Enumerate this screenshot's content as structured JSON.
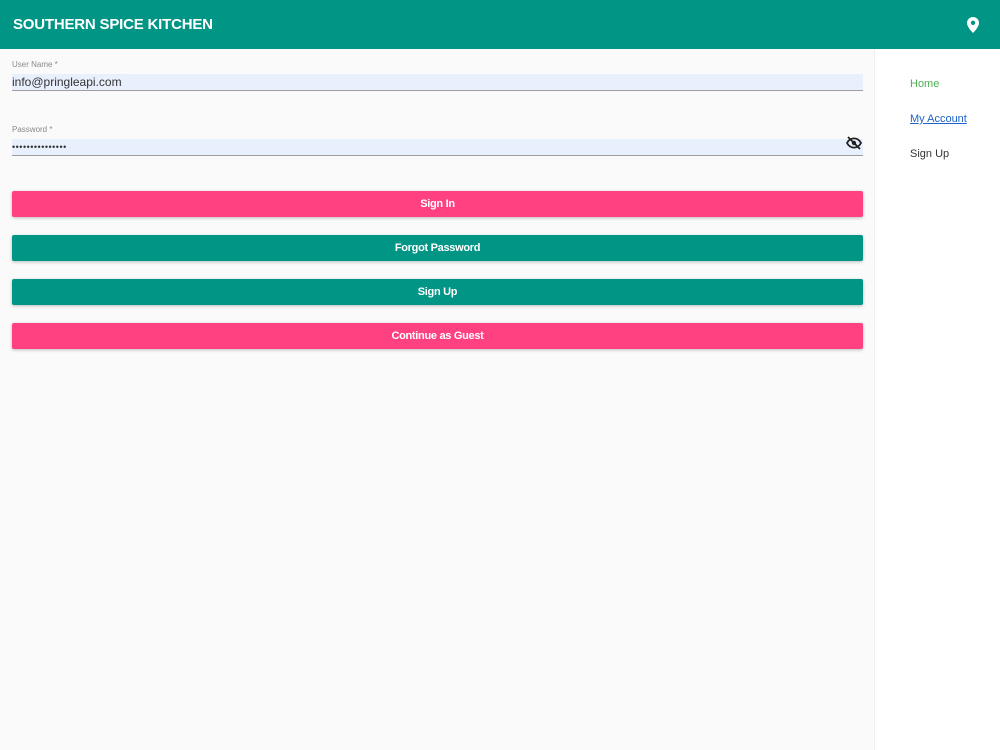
{
  "header": {
    "title": "SOUTHERN SPICE KITCHEN",
    "location_icon": "location-pin-icon"
  },
  "form": {
    "username": {
      "label": "User Name *",
      "value": "info@pringleapi.com"
    },
    "password": {
      "label": "Password *",
      "value": "•••••••••••••••",
      "toggle_icon": "eye-off-icon"
    }
  },
  "buttons": {
    "sign_in": "Sign In",
    "forgot_password": "Forgot Password",
    "sign_up": "Sign Up",
    "guest": "Continue as Guest"
  },
  "nav": {
    "items": [
      {
        "label": "Home"
      },
      {
        "label": "My Account"
      },
      {
        "label": "Sign Up"
      }
    ]
  },
  "colors": {
    "primary": "#009585",
    "accent": "#ff4081",
    "nav_home": "#4caf50",
    "nav_link": "#1e63c7"
  }
}
